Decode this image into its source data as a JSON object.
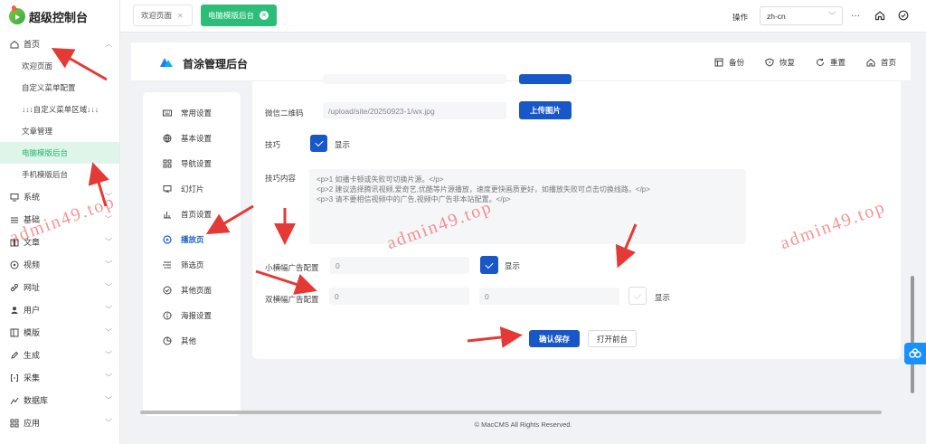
{
  "app": {
    "title": "超级控制台"
  },
  "sidebar": {
    "groups": [
      {
        "label": "首页",
        "icon": "home-icon",
        "open": true
      },
      {
        "label": "系统",
        "icon": "monitor-icon"
      },
      {
        "label": "基础",
        "icon": "layers-icon"
      },
      {
        "label": "文章",
        "icon": "book-icon"
      },
      {
        "label": "视频",
        "icon": "play-circle-icon"
      },
      {
        "label": "网址",
        "icon": "link-icon"
      },
      {
        "label": "用户",
        "icon": "user-icon"
      },
      {
        "label": "模版",
        "icon": "template-icon"
      },
      {
        "label": "生成",
        "icon": "edit-icon"
      },
      {
        "label": "采集",
        "icon": "collect-icon"
      },
      {
        "label": "数据库",
        "icon": "database-icon"
      },
      {
        "label": "应用",
        "icon": "apps-icon"
      }
    ],
    "sub_items": [
      {
        "label": "欢迎页面"
      },
      {
        "label": "自定义菜单配置"
      },
      {
        "label": "↓↓↓自定义菜单区域↓↓↓"
      },
      {
        "label": "文章管理"
      },
      {
        "label": "电脑模版后台",
        "active": true
      },
      {
        "label": "手机模版后台"
      }
    ]
  },
  "header": {
    "tabs": [
      {
        "label": "欢迎页面",
        "active": false
      },
      {
        "label": "电脑模版后台",
        "active": true
      }
    ],
    "op_label": "操作",
    "language": "zh-cn",
    "icons": [
      "more-icon",
      "home-icon",
      "check-circle-icon"
    ]
  },
  "panel": {
    "title": "首涂管理后台",
    "actions": [
      {
        "label": "备份",
        "icon": "backup-icon"
      },
      {
        "label": "恢复",
        "icon": "shield-icon"
      },
      {
        "label": "重置",
        "icon": "refresh-icon"
      },
      {
        "label": "首页",
        "icon": "home-icon"
      }
    ]
  },
  "nav": {
    "items": [
      {
        "label": "常用设置",
        "icon": "keyboard-icon"
      },
      {
        "label": "基本设置",
        "icon": "globe-icon"
      },
      {
        "label": "导航设置",
        "icon": "grid-icon"
      },
      {
        "label": "幻灯片",
        "icon": "slides-icon"
      },
      {
        "label": "首页设置",
        "icon": "bar-chart-icon"
      },
      {
        "label": "播放页",
        "icon": "play-icon",
        "active": true
      },
      {
        "label": "筛选页",
        "icon": "filter-icon"
      },
      {
        "label": "其他页面",
        "icon": "check-circle-icon"
      },
      {
        "label": "海报设置",
        "icon": "info-icon"
      },
      {
        "label": "其他",
        "icon": "pie-icon"
      }
    ]
  },
  "form": {
    "wechat_qr": {
      "label": "微信二维码",
      "value": "/upload/site/20250923-1/wx.jpg",
      "upload_label": "上传图片"
    },
    "tips": {
      "label": "技巧",
      "checked": true,
      "check_label": "显示"
    },
    "tips_content": {
      "label": "技巧内容",
      "lines": [
        "<p>1 如播卡顿或失败可切换片源。</p>",
        "<p>2 建议选择腾讯视频,爱奇艺,优酷等片源播放，速度更快画质更好，如播放失败可点击切换线路。</p>",
        "<p>3 请不要相信视频中的广告,视频中广告非本站配置。</p>"
      ]
    },
    "small_ad": {
      "label": "小横幅广告配置",
      "value": "0",
      "checked": true,
      "check_label": "显示"
    },
    "double_ad": {
      "label": "双横幅广告配置",
      "value1": "0",
      "value2": "0",
      "checked": false,
      "check_label": "显示"
    },
    "save_label": "确认保存",
    "front_label": "打开前台"
  },
  "footer": {
    "text": "© MacCMS All Rights Reserved."
  },
  "watermark": {
    "text": "admin49.top"
  },
  "colors": {
    "accent_green": "#2dbd78",
    "primary_blue": "#1757c7",
    "annotation_red": "#e53935"
  }
}
